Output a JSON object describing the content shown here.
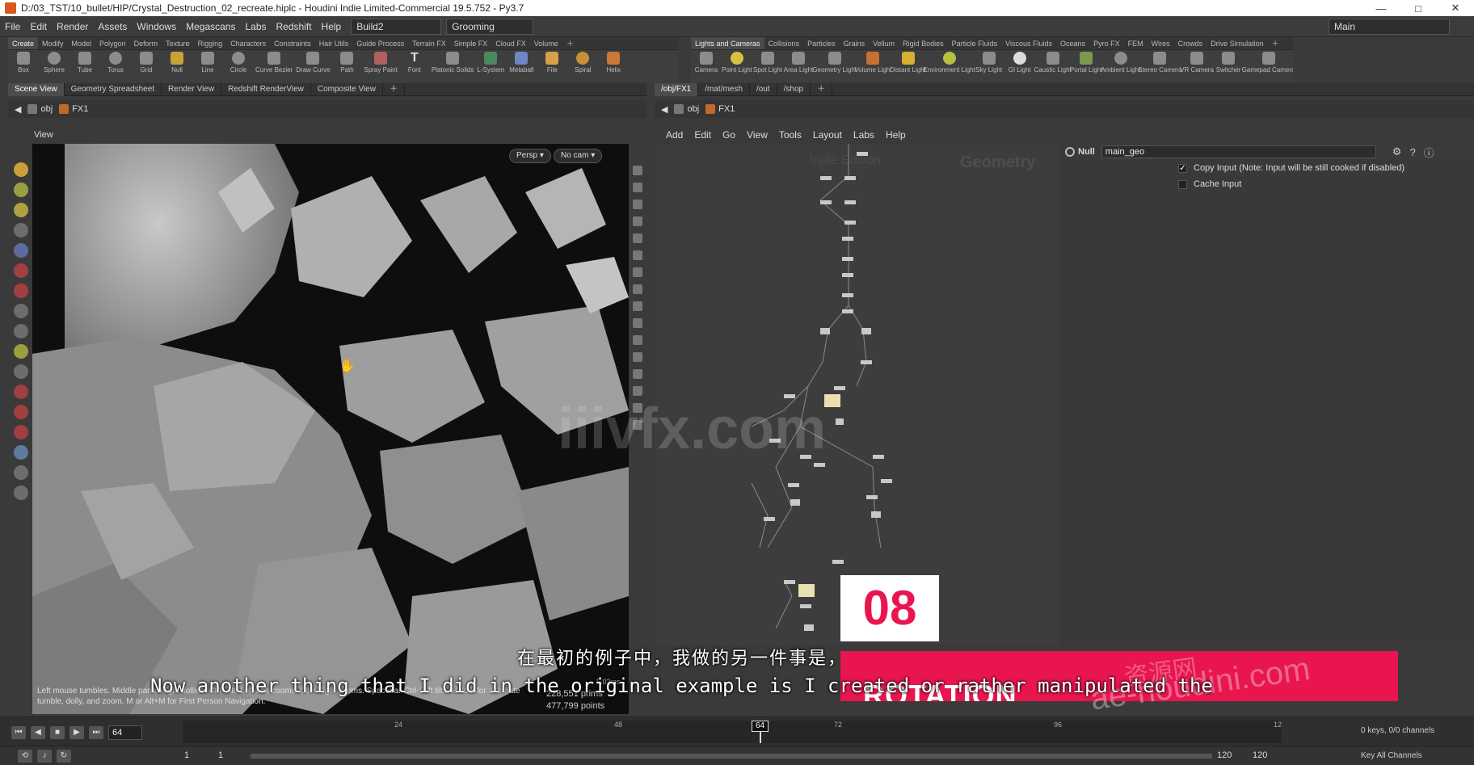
{
  "window": {
    "title": "D:/03_TST/10_bullet/HIP/Crystal_Destruction_02_recreate.hiplc - Houdini Indie Limited-Commercial 19.5.752 - Py3.7",
    "minimize": "—",
    "maximize": "□",
    "close": "✕"
  },
  "menubar": {
    "items": [
      "File",
      "Edit",
      "Render",
      "Assets",
      "Windows",
      "Megascans",
      "Labs",
      "Redshift",
      "Help"
    ],
    "desktop": "Build2",
    "context": "Grooming",
    "workspace": "Main"
  },
  "shelf_left": {
    "tabs": [
      "Create",
      "Modify",
      "Model",
      "Polygon",
      "Deform",
      "Texture",
      "Rigging",
      "Characters",
      "Constraints",
      "Hair Utils",
      "Guide Process",
      "Terrain FX",
      "Simple FX",
      "Cloud FX",
      "Volume"
    ],
    "tools": [
      "Box",
      "Sphere",
      "Tube",
      "Torus",
      "Grid",
      "Null",
      "Line",
      "Circle",
      "Curve Bezier",
      "Draw Curve",
      "Path",
      "Spray Paint",
      "Font",
      "Platonic Solids",
      "L-System",
      "Metaball",
      "File",
      "Spiral",
      "Helix"
    ]
  },
  "shelf_right": {
    "tabs": [
      "Lights and Cameras",
      "Collisions",
      "Particles",
      "Grains",
      "Vellum",
      "Rigid Bodies",
      "Particle Fluids",
      "Viscous Fluids",
      "Oceans",
      "Pyro FX",
      "FEM",
      "Wires",
      "Crowds",
      "Drive Simulation"
    ],
    "tools": [
      "Camera",
      "Point Light",
      "Spot Light",
      "Area Light",
      "Geometry Light",
      "Volume Light",
      "Distant Light",
      "Environment Light",
      "Sky Light",
      "GI Light",
      "Caustic Light",
      "Portal Light",
      "Ambient Light",
      "Stereo Camera",
      "VR Camera",
      "Switcher",
      "Gamepad Camera"
    ]
  },
  "left_pane": {
    "tabs": [
      "Scene View",
      "Geometry Spreadsheet",
      "Render View",
      "Redshift RenderView",
      "Composite View"
    ],
    "path": [
      "obj",
      "FX1"
    ],
    "view_label": "View",
    "persp": "Persp ▾",
    "cam": "No cam ▾",
    "hint": "Left mouse tumbles. Middle pans. Right dollies. Ctrl+Alt+Left box-zooms. Ctrl+Right zooms. Spacebar-Ctrl-Left tilts. Hold L for alternate tumble, dolly, and zoom.    M or Alt+M for First Person Navigation.",
    "stats": [
      "228,551  prims",
      "477,799  points"
    ],
    "stat_time": "5.03ms"
  },
  "right_pane": {
    "tabs": [
      "/obj/FX1",
      "/mat/mesh",
      "/out",
      "/shop"
    ],
    "path": [
      "obj",
      "FX1"
    ],
    "menu": [
      "Add",
      "Edit",
      "Go",
      "View",
      "Tools",
      "Layout",
      "Labs",
      "Help"
    ],
    "watermark_edition": "Indie Edition",
    "watermark_context": "Geometry",
    "node_type": "Null",
    "node_name": "main_geo",
    "params": [
      {
        "label": "Copy Input (Note: Input will be still cooked if disabled)",
        "checked": "✓"
      },
      {
        "label": "Cache Input",
        "checked": ""
      }
    ]
  },
  "timeline": {
    "current_frame": "64",
    "marker": "64",
    "ticks": [
      "24",
      "48",
      "72",
      "96",
      "12"
    ],
    "start": "1",
    "start2": "1",
    "end": "120",
    "end2": "120",
    "keys_info": "0 keys, 0/0 channels",
    "key_all": "Key All Channels"
  },
  "overlay": {
    "subtitle_zh": "在最初的例子中，我做的另一件事是，",
    "subtitle_en": "Now another thing that I did in the original example is I created or rather manipulated the",
    "badge": "08",
    "banner": "ROTATION",
    "watermark": "iiivfx.com",
    "watermark2": "ae-houdini.com",
    "watermark3": "资源网"
  }
}
